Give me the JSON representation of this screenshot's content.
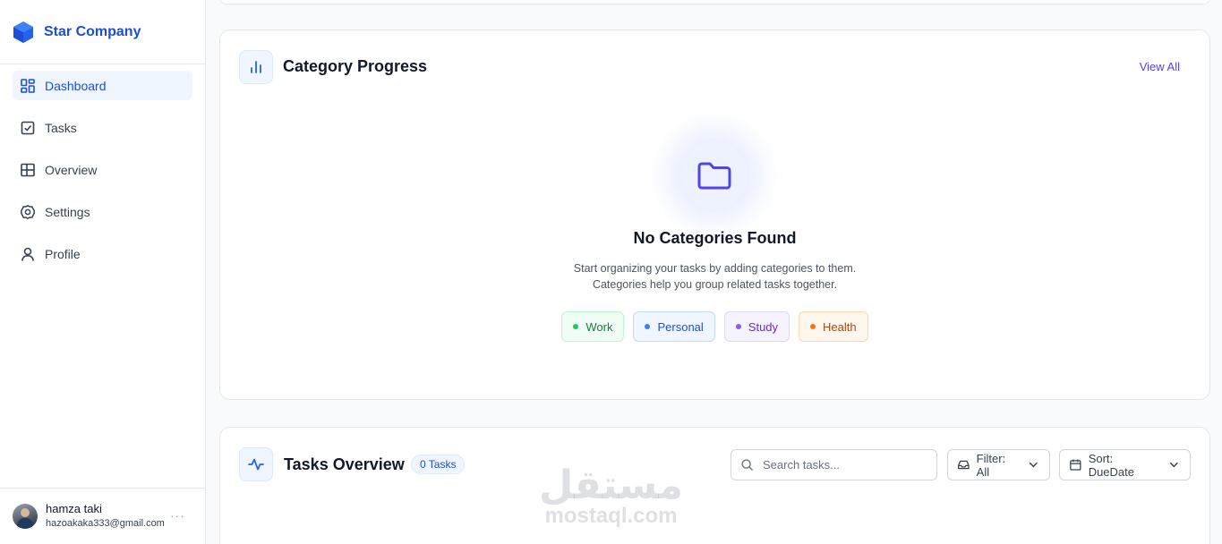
{
  "brand": {
    "name": "Star Company",
    "color": "#1d4ed8"
  },
  "nav": {
    "items": [
      {
        "label": "Dashboard",
        "icon": "dashboard-icon",
        "active": true
      },
      {
        "label": "Tasks",
        "icon": "checkbox-icon"
      },
      {
        "label": "Overview",
        "icon": "grid-icon"
      },
      {
        "label": "Settings",
        "icon": "gear-icon"
      },
      {
        "label": "Profile",
        "icon": "user-icon"
      }
    ]
  },
  "user": {
    "name": "hamza taki",
    "email": "hazoakaka333@gmail.com",
    "more": "···"
  },
  "category_progress": {
    "title": "Category Progress",
    "view_all": "View All",
    "empty_title": "No Categories Found",
    "empty_line1": "Start organizing your tasks by adding categories to them.",
    "empty_line2": "Categories help you group related tasks together.",
    "chips": [
      "Work",
      "Personal",
      "Study",
      "Health"
    ]
  },
  "tasks_overview": {
    "title": "Tasks Overview",
    "badge": "0 Tasks",
    "search_placeholder": "Search tasks...",
    "filter_label": "Filter: All",
    "sort_label": "Sort: DueDate"
  },
  "watermark": {
    "arabic": "مستقل",
    "latin": "mostaql.com"
  },
  "colors": {
    "accent": "#4f46e5",
    "primary": "#1d4ed8",
    "active_bg": "#eff6ff"
  }
}
